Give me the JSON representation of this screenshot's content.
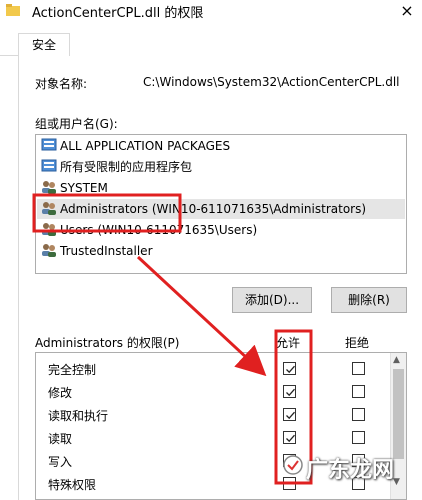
{
  "window": {
    "title": "ActionCenterCPL.dll 的权限",
    "close_glyph": "×"
  },
  "tabs": [
    {
      "label": "安全"
    }
  ],
  "object": {
    "label": "对象名称:",
    "value": "C:\\Windows\\System32\\ActionCenterCPL.dll"
  },
  "groups": {
    "label": "组或用户名(G):",
    "items": [
      {
        "label": "ALL APPLICATION PACKAGES",
        "icon": "app-packages-icon"
      },
      {
        "label": "所有受限制的应用程序包",
        "icon": "app-packages-icon"
      },
      {
        "label": "SYSTEM",
        "icon": "users-group-icon"
      },
      {
        "label": "Administrators (WIN10-611071635\\Administrators)",
        "icon": "users-group-icon",
        "selected": true
      },
      {
        "label": "Users (WIN10-611071635\\Users)",
        "icon": "users-group-icon"
      },
      {
        "label": "TrustedInstaller",
        "icon": "users-group-icon"
      }
    ]
  },
  "buttons": {
    "add": "添加(D)...",
    "remove": "删除(R)"
  },
  "permissions": {
    "label": "Administrators 的权限(P)",
    "allow_header": "允许",
    "deny_header": "拒绝",
    "rows": [
      {
        "name": "完全控制",
        "allow": true,
        "deny": false
      },
      {
        "name": "修改",
        "allow": true,
        "deny": false
      },
      {
        "name": "读取和执行",
        "allow": true,
        "deny": false
      },
      {
        "name": "读取",
        "allow": true,
        "deny": false
      },
      {
        "name": "写入",
        "allow": true,
        "deny": false
      },
      {
        "name": "特殊权限",
        "allow": false,
        "deny": false
      }
    ]
  },
  "annotation": {
    "color": "#e02020"
  },
  "watermark": {
    "text": "广东龙网"
  }
}
